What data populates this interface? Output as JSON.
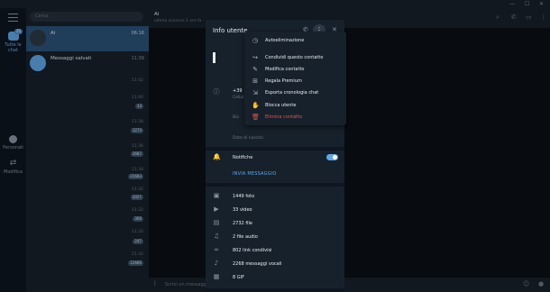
{
  "window": {
    "minimize": "—",
    "maximize": "☐",
    "close": "✕"
  },
  "folders": [
    {
      "label": "Tutte le chat",
      "badge": "25",
      "active": true,
      "icon": "chats-icon"
    },
    {
      "label": "Personali",
      "badge": "",
      "active": false,
      "icon": "person-icon"
    },
    {
      "label": "Modifica",
      "badge": "",
      "active": false,
      "icon": "sliders-icon"
    }
  ],
  "search": {
    "placeholder": "Cerca"
  },
  "chats": [
    {
      "name": "Ai",
      "time": "06:16",
      "selected": true
    },
    {
      "name": "Messaggi salvati",
      "time": "11:39",
      "selected": false
    }
  ],
  "list_right": {
    "times": [
      "11:42",
      "11:40",
      "11:38",
      "11:36",
      "11:34",
      "11:32",
      "11:32",
      "11:32",
      "11:32",
      "11:31",
      "11:30",
      "11:32"
    ],
    "badges": [
      "13",
      "1273",
      "2687",
      "21683",
      "2027",
      "306",
      "247",
      "12680"
    ]
  },
  "chat_header": {
    "title": "Ai",
    "subtitle": "ultimo accesso 1 ore fa"
  },
  "composer": {
    "placeholder": "Scrivi un messaggio..."
  },
  "info": {
    "title": "Info utente",
    "phone": "+39",
    "phone_label": "Cellulare",
    "bio_label": "Bio",
    "birth_label": "Data di nascita",
    "notifications": "Notifiche",
    "send_message": "INVIA MESSAGGIO",
    "media": [
      {
        "icon": "photo-icon",
        "label": "1449 foto"
      },
      {
        "icon": "video-icon",
        "label": "33 video"
      },
      {
        "icon": "file-icon",
        "label": "2732 file"
      },
      {
        "icon": "headphones-icon",
        "label": "2 file audio"
      },
      {
        "icon": "link-icon",
        "label": "802 link condivisi"
      },
      {
        "icon": "mic-icon",
        "label": "2268 messaggi vocali"
      },
      {
        "icon": "gif-icon",
        "label": "8 GIF"
      }
    ]
  },
  "dropdown": {
    "items": [
      {
        "icon": "timer-icon",
        "glyph": "◷",
        "label": "Autoeliminazione",
        "danger": false
      },
      {
        "icon": "share-icon",
        "glyph": "↪",
        "label": "Condividi questo contatto",
        "danger": false
      },
      {
        "icon": "edit-icon",
        "glyph": "✎",
        "label": "Modifica contatto",
        "danger": false
      },
      {
        "icon": "gift-icon",
        "glyph": "⊞",
        "label": "Regala Premium",
        "danger": false
      },
      {
        "icon": "export-icon",
        "glyph": "⇲",
        "label": "Esporta cronologia chat",
        "danger": false
      },
      {
        "icon": "block-icon",
        "glyph": "✋",
        "label": "Blocca utente",
        "danger": false
      },
      {
        "icon": "trash-icon",
        "glyph": "🗑",
        "label": "Elimina contatto",
        "danger": true
      }
    ]
  },
  "colors": {
    "accent": "#5fa8e9",
    "danger": "#e5534b",
    "panel": "#17212b",
    "background": "#0e1621"
  }
}
